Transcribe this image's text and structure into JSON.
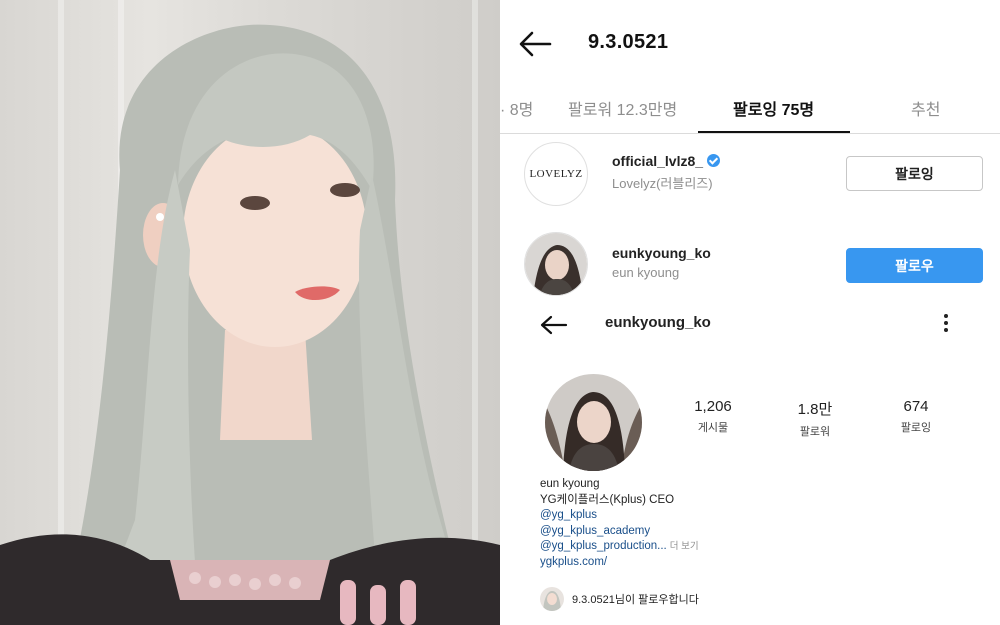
{
  "header": {
    "title": "9.3.0521"
  },
  "tabs": [
    {
      "label": "· 8명",
      "active": false
    },
    {
      "label": "팔로워 12.3만명",
      "active": false
    },
    {
      "label": "팔로잉 75명",
      "active": true
    },
    {
      "label": "추천",
      "active": false
    }
  ],
  "following_list": [
    {
      "username": "official_lvlz8_",
      "display_name": "Lovelyz(러블리즈)",
      "avatar_text": "LOVELYZ",
      "verified": true,
      "button_label": "팔로잉",
      "button_style": "outline"
    },
    {
      "username": "eunkyoung_ko",
      "display_name": "eun kyoung",
      "verified": false,
      "button_label": "팔로우",
      "button_style": "primary"
    }
  ],
  "profile": {
    "username": "eunkyoung_ko",
    "stats": [
      {
        "value": "1,206",
        "label": "게시물"
      },
      {
        "value": "1.8만",
        "label": "팔로워"
      },
      {
        "value": "674",
        "label": "팔로잉"
      }
    ],
    "bio_name": "eun kyoung",
    "bio_line": "YG케이플러스(Kplus) CEO",
    "bio_links": [
      "@yg_kplus",
      "@yg_kplus_academy",
      "@yg_kplus_production..."
    ],
    "more_label": "더 보기",
    "website": "ygkplus.com/",
    "followed_by_text": "9.3.0521님이 팔로우합니다"
  },
  "colors": {
    "primary_button": "#3897f0",
    "link": "#1a4f8a",
    "muted_text": "#8e8e8e",
    "divider": "#dbdbdb"
  },
  "icons": {
    "back": "back-arrow-icon",
    "verified": "verified-badge-icon",
    "more": "more-vertical-icon"
  }
}
